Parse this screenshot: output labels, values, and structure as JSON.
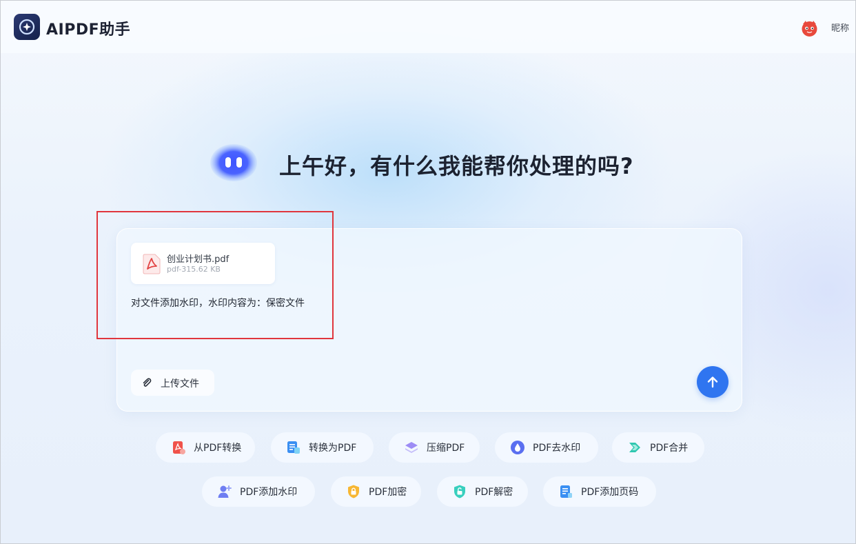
{
  "header": {
    "app_title": "AIPDF助手",
    "nickname": "昵称"
  },
  "greeting": "上午好，有什么我能帮你处理的吗?",
  "chat": {
    "attachment": {
      "file_name": "创业计划书.pdf",
      "file_meta": "pdf-315.62 KB"
    },
    "prompt": "对文件添加水印，水印内容为：保密文件",
    "upload_label": "上传文件"
  },
  "tools_row1": [
    {
      "label": "从PDF转换",
      "icon": "pdf-convert-from-icon"
    },
    {
      "label": "转换为PDF",
      "icon": "convert-to-pdf-icon"
    },
    {
      "label": "压缩PDF",
      "icon": "compress-pdf-icon"
    },
    {
      "label": "PDF去水印",
      "icon": "remove-watermark-icon"
    },
    {
      "label": "PDF合并",
      "icon": "merge-pdf-icon"
    }
  ],
  "tools_row2": [
    {
      "label": "PDF添加水印",
      "icon": "add-watermark-icon"
    },
    {
      "label": "PDF加密",
      "icon": "encrypt-pdf-icon"
    },
    {
      "label": "PDF解密",
      "icon": "decrypt-pdf-icon"
    },
    {
      "label": "PDF添加页码",
      "icon": "add-page-number-icon"
    }
  ],
  "colors": {
    "accent": "#2f75f0",
    "highlight": "#e0353c",
    "title_text": "#1c2230"
  }
}
